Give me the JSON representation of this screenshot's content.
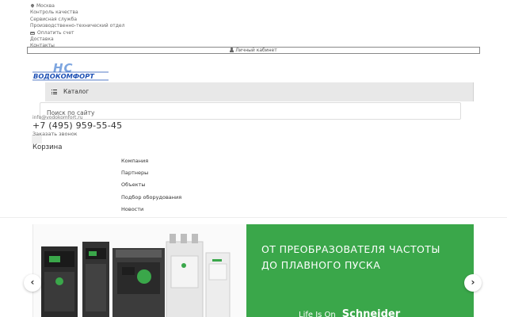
{
  "topbar": {
    "city": "Москва",
    "links": [
      "Контроль качества",
      "Сервисная служба",
      "Производственно-технический отдел"
    ],
    "pay_invoice": "Оплатить счет",
    "links2": [
      "Доставка",
      "Контакты"
    ]
  },
  "account": {
    "label": "Личный кабинет"
  },
  "logo": {
    "letters": "НС",
    "text": "ВОДОКОМФОРТ",
    "color": "#1c4fb4",
    "light_color": "#7ea6e0"
  },
  "catalog": {
    "label": "Каталог"
  },
  "search": {
    "placeholder": "Поиск по сайту"
  },
  "contacts": {
    "email": "info@vodokomfort.ru",
    "phone": "+7 (495) 959-55-45",
    "callback": "Заказать звонок"
  },
  "cart": {
    "label": "Корзина"
  },
  "nav": {
    "items": [
      "Компания",
      "Партнеры",
      "Объекты",
      "Подбор оборудования",
      "Новости"
    ]
  },
  "banner": {
    "headline_line1": "ОТ ПРЕОБРАЗОВАТЕЛЯ ЧАСТОТЫ",
    "headline_line2": "ДО ПЛАВНОГО ПУСКА",
    "slogan": "Life Is On",
    "brand": "Schneider",
    "green": "#3aa74a",
    "prev_symbol": "‹",
    "next_symbol": "›"
  }
}
